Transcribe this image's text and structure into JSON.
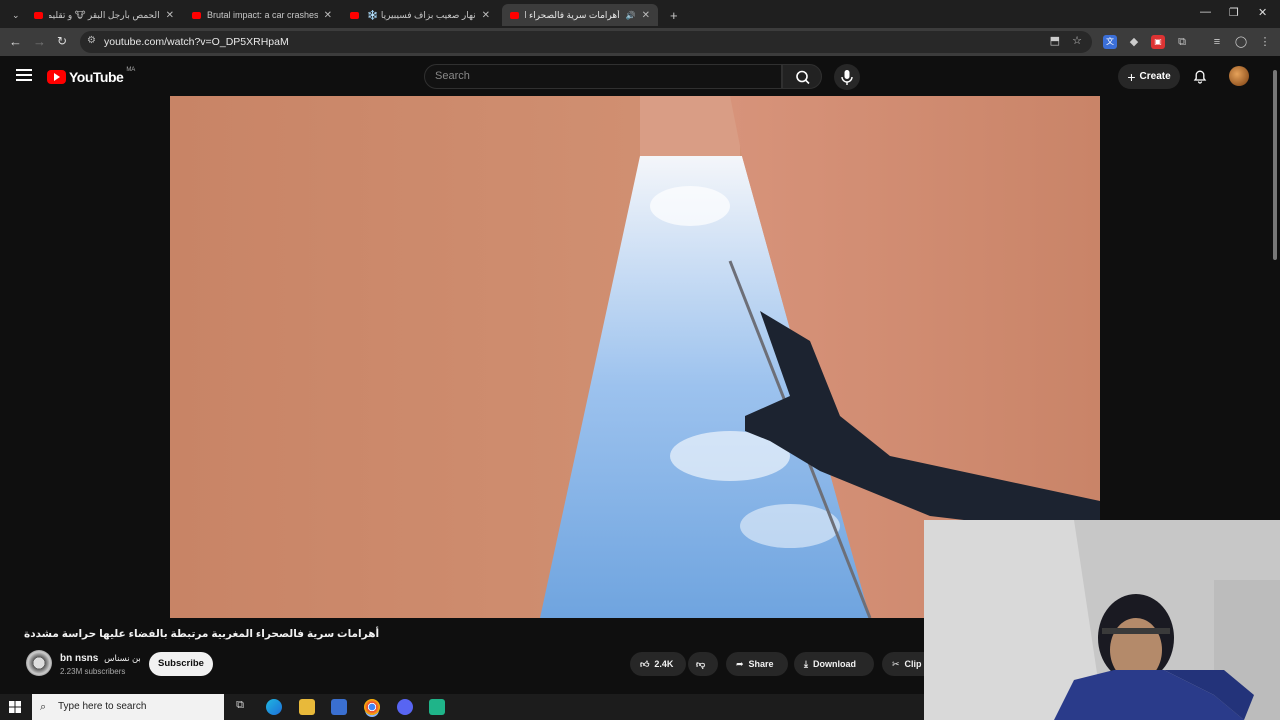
{
  "browser": {
    "tabs": [
      {
        "title": "الحمص بأرجل البقر 🐮 و تقليم أ...",
        "active": false
      },
      {
        "title": "Brutal impact: a car crashes",
        "active": false
      },
      {
        "title": "نهار صعيب بزاف فسيبيريا ❄️ جلد...",
        "active": false
      },
      {
        "title": "أهرامات سرية فالصحراء المغ...",
        "active": true
      }
    ],
    "new_tab": "+",
    "url": "youtube.com/watch?v=O_DP5XRHpaM"
  },
  "youtube": {
    "logo_text": "YouTube",
    "country_code": "MA",
    "search_placeholder": "Search",
    "create_label": "Create"
  },
  "video": {
    "title": "أهرامات سرية فالصحراء المغربية مرتبطة بالفضاء عليها حراسة مشددة",
    "channel_name": "bn nsns",
    "channel_alias": "بن نسناس",
    "subscribers": "2.23M subscribers",
    "subscribe_label": "Subscribe",
    "likes": "2.4K",
    "share_label": "Share",
    "download_label": "Download",
    "clip_label": "Clip"
  },
  "taskbar": {
    "search_placeholder": "Type here to search"
  },
  "colors": {
    "youtube_red": "#ff0000",
    "background": "#0f0f0f",
    "chrome_tabbar": "#1f1f1f",
    "chrome_toolbar": "#3c3c3c"
  }
}
